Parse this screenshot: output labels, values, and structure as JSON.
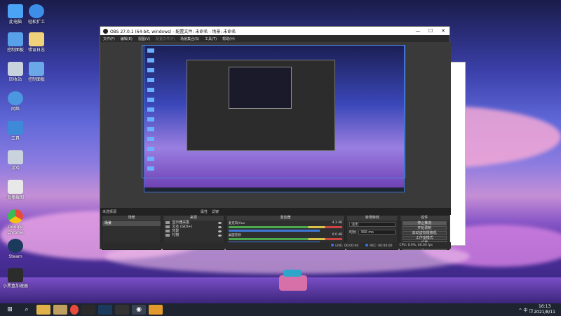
{
  "desktop": {
    "icons": [
      {
        "label": "此电脑",
        "color": "#4aa3f5"
      },
      {
        "label": "轻松扩工",
        "color": "#3d8ee8"
      },
      {
        "label": "控制面板",
        "color": "#58a0e8"
      },
      {
        "label": "错误日志",
        "color": "#f0d27a"
      },
      {
        "label": "回收站",
        "color": "#c8d3de"
      },
      {
        "label": "控制面板",
        "color": "#6aa8e8"
      },
      {
        "label": "网络",
        "color": "#4c98e0"
      },
      {
        "label": "工具",
        "color": "#3f8ad8"
      },
      {
        "label": "游戏",
        "color": "#c8d3de"
      },
      {
        "label": "直播截图",
        "color": "#e8e8e8"
      },
      {
        "label": "Google Chrome",
        "color": "#e84b3c"
      },
      {
        "label": "Steam",
        "color": "#1b3a5c"
      },
      {
        "label": "小黑盒加速器",
        "color": "#2c2c2c"
      }
    ]
  },
  "obs": {
    "title": "OBS 27.0.1 (64-bit, windows) - 配置文件: 未命名 - 场景: 未命名",
    "window_controls": [
      "—",
      "☐",
      "✕"
    ],
    "menu": [
      "文件(F)",
      "编辑(E)",
      "视图(V)",
      "配置文件(P)",
      "场景集合(S)",
      "工具(T)",
      "帮助(H)"
    ],
    "scene_header": {
      "label": "未选择源",
      "properties": "属性",
      "filters": "滤镜"
    },
    "docks": {
      "scenes": {
        "title": "场景",
        "items": [
          "场景"
        ]
      },
      "sources": {
        "title": "来源",
        "items": [
          "显示器采集",
          "文本 (GDI+)",
          "背景",
          "礼物"
        ]
      },
      "mixer": {
        "title": "混音器",
        "channels": [
          {
            "name": "麦克风/Aux",
            "value": "4.3 dB"
          },
          {
            "name": "桌面音频",
            "value": "0.0 dB"
          }
        ]
      },
      "transitions": {
        "title": "转场特效",
        "type": "淡出",
        "duration_label": "时长",
        "duration": "300 ms"
      },
      "controls": {
        "title": "控件",
        "buttons": [
          "停止推流",
          "开始录制",
          "启动虚拟摄像机",
          "工作室模式",
          "设置",
          "退出"
        ]
      }
    },
    "status": {
      "live_label": "LIVE:",
      "live_time": "00:00:00",
      "rec_label": "REC:",
      "rec_time": "00:00:00",
      "cpu": "CPU: 0.9%, 60.00 fps"
    }
  },
  "taskbar": {
    "tray": "^ 中 ◫",
    "time": "16:13",
    "date": "2021/8/11"
  }
}
